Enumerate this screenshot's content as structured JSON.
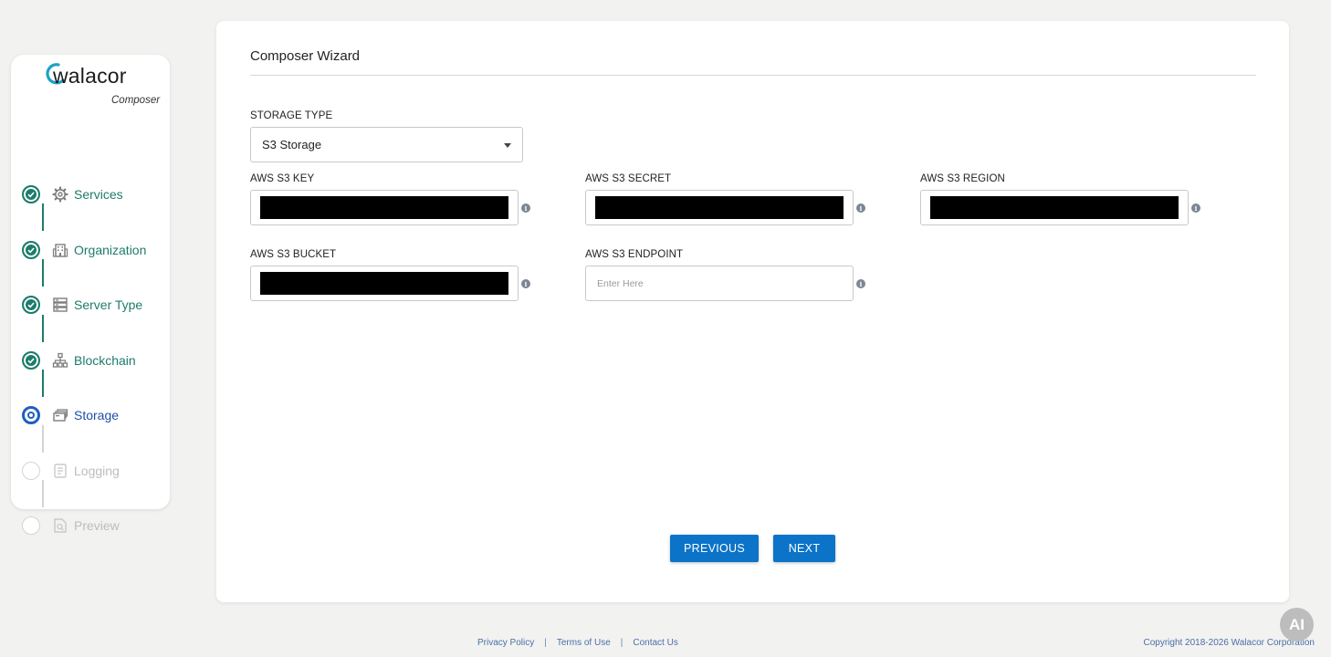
{
  "brand": {
    "logo_text": "walacor",
    "logo_subtitle": "Composer",
    "accent_green": "#1d7c6c",
    "accent_blue": "#1f5fbf"
  },
  "sidebar": {
    "steps": [
      {
        "label": "Services",
        "state": "done",
        "icon": "gear-icon"
      },
      {
        "label": "Organization",
        "state": "done",
        "icon": "building-icon"
      },
      {
        "label": "Server Type",
        "state": "done",
        "icon": "server-icon"
      },
      {
        "label": "Blockchain",
        "state": "done",
        "icon": "network-icon"
      },
      {
        "label": "Storage",
        "state": "active",
        "icon": "storage-icon"
      },
      {
        "label": "Logging",
        "state": "pending",
        "icon": "logging-icon"
      },
      {
        "label": "Preview",
        "state": "pending",
        "icon": "preview-icon"
      }
    ]
  },
  "main": {
    "title": "Composer Wizard",
    "storage_type": {
      "label": "STORAGE TYPE",
      "value": "S3 Storage"
    },
    "fields": {
      "key": {
        "label": "AWS S3 KEY"
      },
      "secret": {
        "label": "AWS S3 SECRET"
      },
      "region": {
        "label": "AWS S3 REGION"
      },
      "bucket": {
        "label": "AWS S3 BUCKET"
      },
      "endpoint": {
        "label": "AWS S3 ENDPOINT",
        "placeholder": "Enter Here"
      }
    },
    "buttons": {
      "previous": "PREVIOUS",
      "next": "NEXT"
    }
  },
  "footer": {
    "links": [
      "Privacy Policy",
      "Terms of Use",
      "Contact Us"
    ],
    "separator": "|",
    "copyright": "Copyright 2018-2026 Walacor Corporation"
  },
  "ai_badge": "AI"
}
